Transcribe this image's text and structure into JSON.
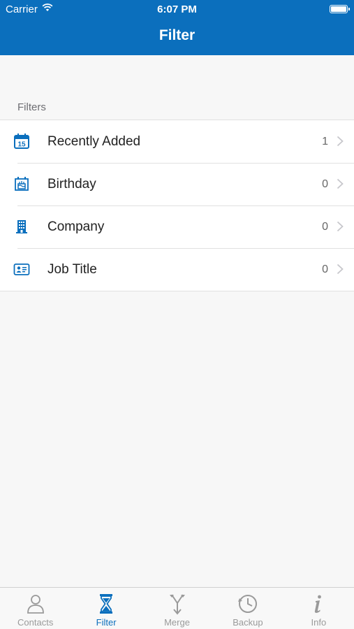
{
  "status_bar": {
    "carrier": "Carrier",
    "time": "6:07 PM"
  },
  "nav": {
    "title": "Filter"
  },
  "section": {
    "label": "Filters"
  },
  "filters": [
    {
      "label": "Recently Added",
      "count": "1",
      "icon": "calendar-15-icon",
      "calendar_day": "15"
    },
    {
      "label": "Birthday",
      "count": "0",
      "icon": "birthday-cake-icon"
    },
    {
      "label": "Company",
      "count": "0",
      "icon": "building-icon"
    },
    {
      "label": "Job Title",
      "count": "0",
      "icon": "id-card-icon"
    }
  ],
  "tabbar": {
    "active": "Filter",
    "tabs": [
      {
        "label": "Contacts",
        "icon": "person-icon"
      },
      {
        "label": "Filter",
        "icon": "hourglass-icon"
      },
      {
        "label": "Merge",
        "icon": "merge-icon"
      },
      {
        "label": "Backup",
        "icon": "clock-icon"
      },
      {
        "label": "Info",
        "icon": "info-icon"
      }
    ]
  },
  "colors": {
    "accent": "#0b6fbd",
    "inactive_tab": "#9a9a9a",
    "background": "#f7f7f7"
  }
}
